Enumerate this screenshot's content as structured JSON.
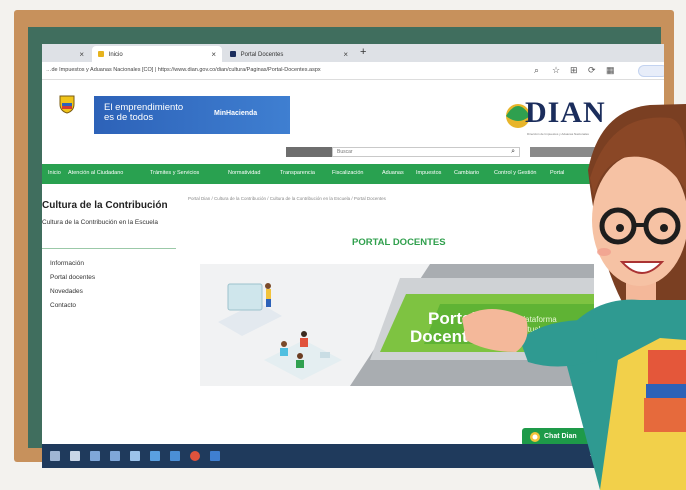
{
  "browser": {
    "tabs": [
      {
        "label": "Inicio",
        "active": true
      },
      {
        "label": "Portal Docentes",
        "active": false
      }
    ],
    "new_tab_icon": "plus-icon",
    "url": "…de Impuestos y Aduanas Nacionales [CO]  |  https://www.dian.gov.co/dian/cultura/Paginas/Portal-Docentes.aspx",
    "toolbar_icons": [
      "search-icon",
      "star-icon",
      "extension-icon",
      "sync-icon",
      "menu-icon"
    ]
  },
  "header": {
    "banner_line1": "El emprendimiento",
    "banner_line2": "es de todos",
    "banner_ministry": "MinHacienda",
    "logo_text": "DIAN",
    "logo_subtext": "Dirección de Impuestos y Aduanas Nacionales",
    "search_placeholder": "Buscar"
  },
  "nav": {
    "items": [
      "Inicio",
      "Atención al Ciudadano",
      "Trámites y Servicios",
      "Normatividad",
      "Transparencia",
      "Fiscalización",
      "Aduanas",
      "Impuestos",
      "Cambiario",
      "Control y Gestión",
      "Portal"
    ]
  },
  "sidebar": {
    "title": "Cultura de la Contribución",
    "subtitle": "Cultura de la Contribución en la Escuela",
    "links": [
      "Información",
      "Portal docentes",
      "Novedades",
      "Contacto"
    ]
  },
  "breadcrumb": "Portal Dian / Cultura de la Contribución / Cultura de la Contribución en la Escuela / Portal Docentes",
  "main": {
    "title": "PORTAL DOCENTES",
    "banner_big": "Portal",
    "banner_big2": "Docentes",
    "banner_platform": "Plataforma",
    "banner_virtual": "Virtual"
  },
  "chat": {
    "label": "Chat Dian"
  },
  "taskbar": {
    "icons": [
      "start-icon",
      "search-icon",
      "task-view-icon",
      "file-explorer-icon",
      "store-icon",
      "mail-icon",
      "edge-icon",
      "chrome-icon",
      "app-icon"
    ]
  },
  "colors": {
    "wood": "#c7915c",
    "board_green": "#406e5e",
    "dian_green": "#29a150",
    "dian_blue": "#1b2d5c",
    "banner_blue": "#2d62b8"
  }
}
